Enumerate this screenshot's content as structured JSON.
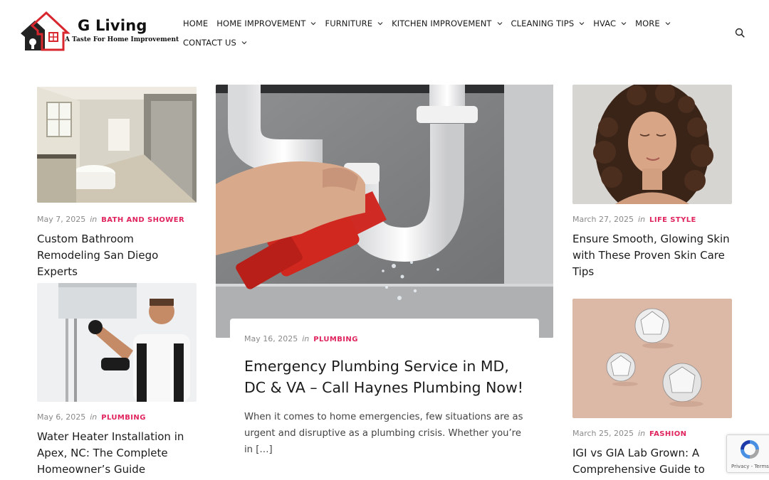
{
  "site": {
    "name": "G Living",
    "tagline": "A Taste For Home Improvement"
  },
  "nav": {
    "row1": [
      {
        "label": "HOME",
        "dropdown": false
      },
      {
        "label": "HOME IMPROVEMENT",
        "dropdown": true
      },
      {
        "label": "FURNITURE",
        "dropdown": true
      },
      {
        "label": "KITCHEN IMPROVEMENT",
        "dropdown": true
      },
      {
        "label": "CLEANING TIPS",
        "dropdown": true
      },
      {
        "label": "HVAC",
        "dropdown": true
      },
      {
        "label": "MORE",
        "dropdown": true
      }
    ],
    "row2": [
      {
        "label": "CONTACT US",
        "dropdown": true
      }
    ]
  },
  "posts": {
    "left1": {
      "date": "May 7, 2025",
      "in": "in",
      "category": "BATH AND SHOWER",
      "title": "Custom Bathroom Remodeling San Diego Experts"
    },
    "left2": {
      "date": "May 6, 2025",
      "in": "in",
      "category": "PLUMBING",
      "title": "Water Heater Installation in Apex, NC: The Complete Homeowner’s Guide"
    },
    "feature": {
      "date": "May 16, 2025",
      "in": "in",
      "category": "PLUMBING",
      "title": "Emergency Plumbing Service in MD, DC & VA – Call Haynes Plumbing Now!",
      "excerpt": "When it comes to home emergencies, few situations are as urgent and disruptive as a plumbing crisis. Whether you’re in […]"
    },
    "right1": {
      "date": "March 27, 2025",
      "in": "in",
      "category": "LIFE STYLE",
      "title": "Ensure Smooth, Glowing Skin with These Proven Skin Care Tips"
    },
    "right2": {
      "date": "March 25, 2025",
      "in": "in",
      "category": "FASHION",
      "title": "IGI vs GIA Lab Grown: A Comprehensive Guide to Lab"
    }
  },
  "recaptcha": {
    "links": "Privacy - Terms"
  },
  "colors": {
    "accent": "#e0245e",
    "logo_red": "#d7262d"
  },
  "icons": [
    "house-logo-icon",
    "chevron-down-icon",
    "search-icon",
    "recaptcha-icon"
  ]
}
